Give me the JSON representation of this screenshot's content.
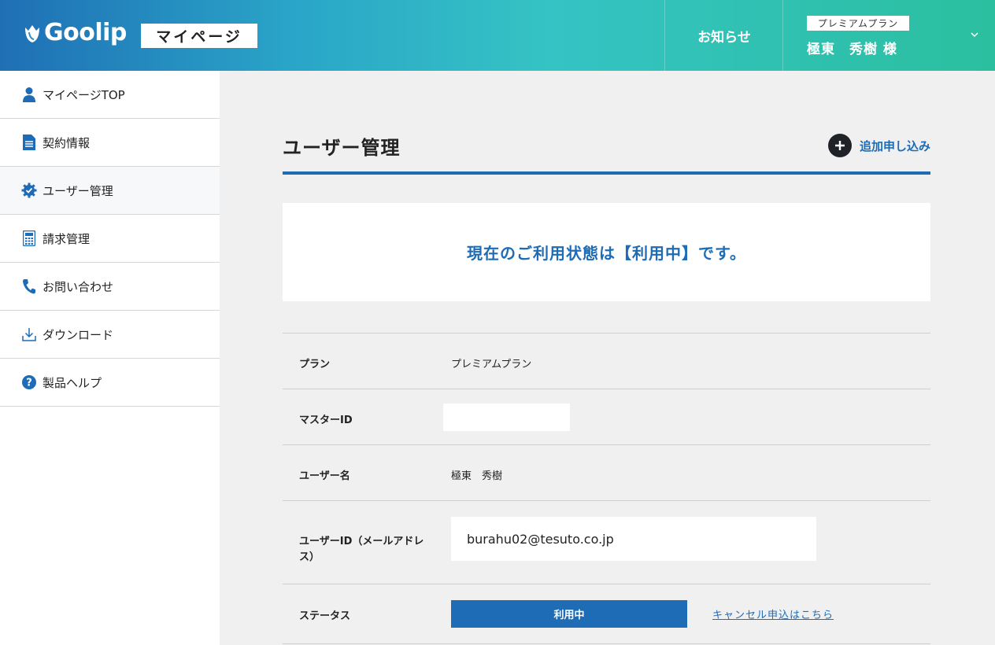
{
  "header": {
    "logo_text": "Goolip",
    "mypage_label": "マイページ",
    "notice_label": "お知らせ",
    "plan_chip": "プレミアムプラン",
    "user_name": "極東　秀樹 様"
  },
  "sidebar": {
    "items": [
      {
        "label": "マイページTOP",
        "icon": "user-icon"
      },
      {
        "label": "契約情報",
        "icon": "document-icon"
      },
      {
        "label": "ユーザー管理",
        "icon": "gear-check-icon"
      },
      {
        "label": "請求管理",
        "icon": "calculator-icon"
      },
      {
        "label": "お問い合わせ",
        "icon": "phone-icon"
      },
      {
        "label": "ダウンロード",
        "icon": "download-icon"
      },
      {
        "label": "製品ヘルプ",
        "icon": "help-icon"
      }
    ]
  },
  "main": {
    "page_title": "ユーザー管理",
    "add_label": "追加申し込み",
    "status_message": "現在のご利用状態は【利用中】です。",
    "rows": {
      "plan": {
        "label": "プラン",
        "value": "プレミアムプラン"
      },
      "master_id": {
        "label": "マスターID",
        "value": ""
      },
      "user_name": {
        "label": "ユーザー名",
        "value": "極東　秀樹"
      },
      "user_id": {
        "label_line1": "ユーザーID（メールアドレ",
        "label_line2": "ス）",
        "value": "burahu02@tesuto.co.jp"
      },
      "status": {
        "label": "ステータス",
        "button": "利用中",
        "cancel_link": "キャンセル申込はこちら"
      }
    }
  },
  "colors": {
    "accent": "#1d6cb5",
    "header_gradient_start": "#1f6fb5",
    "header_gradient_end": "#2bbf9f"
  }
}
